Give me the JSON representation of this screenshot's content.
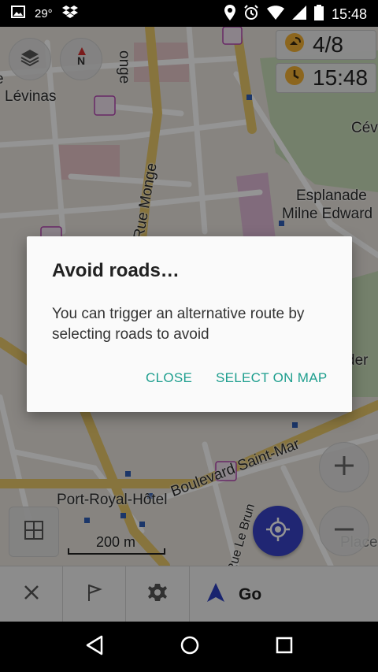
{
  "status_bar": {
    "temperature": "29°",
    "time": "15:48",
    "icons": [
      "image-icon",
      "dropbox-icon",
      "location-pin-icon",
      "alarm-icon",
      "wifi-icon",
      "battery-icon"
    ]
  },
  "map": {
    "compass_letter": "N",
    "widgets": {
      "gps_satellites": "4/8",
      "clock": "15:48"
    },
    "labels": {
      "levinas": "Lévinas",
      "e_top": "e",
      "rue_monge_top": "onge",
      "rue_monge": "Rue Monge",
      "esplanade_1": "Esplanade",
      "esplanade_2": "Milne Edward",
      "cev": "Cév",
      "der": "der",
      "boulevard": "Boulevard Saint-Mar",
      "port_royal": "Port-Royal-Hôtel",
      "le_brun": "Rue Le Brun",
      "place": "Place",
      "scale": "200 m"
    }
  },
  "dialog": {
    "title": "Avoid roads…",
    "message": "You can trigger an alternative route by selecting roads to avoid",
    "close_label": "CLOSE",
    "select_label": "SELECT ON MAP"
  },
  "toolbar": {
    "go_label": "Go"
  },
  "colors": {
    "accent": "#1e9e8e",
    "location_button": "#3743c6",
    "road_yellow": "#e8c86a"
  }
}
